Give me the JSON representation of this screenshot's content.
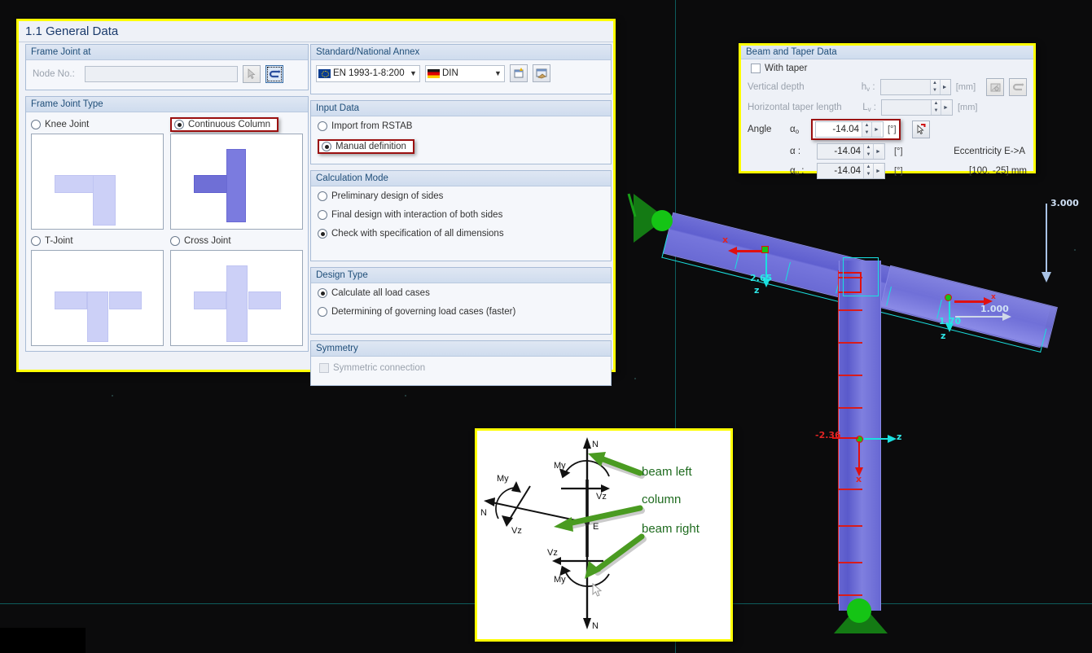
{
  "viewport": {
    "labels": [
      {
        "name": "dim-3000",
        "text": "3.000",
        "color": "#cfe0f5"
      },
      {
        "name": "dim-1000",
        "text": "1.000",
        "color": "#e8eef8"
      },
      {
        "name": "dim-265",
        "text": "2.65",
        "color": "#2ee6e6"
      },
      {
        "name": "dim-170",
        "text": "1.70",
        "color": "#2ee6e6"
      },
      {
        "name": "dim-236",
        "text": "-2.36",
        "color": "#e02424"
      },
      {
        "name": "axis-z-beam-top",
        "text": "z",
        "color": "#2ee6e6"
      },
      {
        "name": "axis-z-beam-mid",
        "text": "z",
        "color": "#2ee6e6"
      },
      {
        "name": "axis-z-column",
        "text": "z",
        "color": "#2ee6e6"
      },
      {
        "name": "axis-x-beam-top",
        "text": "x",
        "color": "#e02424"
      },
      {
        "name": "axis-x-beam-mid",
        "text": "x",
        "color": "#e02424"
      },
      {
        "name": "axis-x-column",
        "text": "x",
        "color": "#e02424"
      }
    ]
  },
  "general_dialog": {
    "title": "1.1 General Data",
    "frame_joint_at": {
      "group_label": "Frame Joint at",
      "node_label": "Node No.:",
      "node_value": "",
      "pick_icon": "pick-cursor-icon",
      "jump_icon": "jump-to-model-icon"
    },
    "frame_joint_type": {
      "group_label": "Frame Joint Type",
      "options": [
        {
          "label": "Knee Joint",
          "selected": false,
          "thumb": "knee-joint-thumbnail"
        },
        {
          "label": "Continuous Column",
          "selected": true,
          "thumb": "continuous-column-thumbnail"
        },
        {
          "label": "T-Joint",
          "selected": false,
          "thumb": "t-joint-thumbnail"
        },
        {
          "label": "Cross Joint",
          "selected": false,
          "thumb": "cross-joint-thumbnail"
        }
      ]
    },
    "standard_annex": {
      "group_label": "Standard/National Annex",
      "standard_value": "EN 1993-1-8:200",
      "standard_flag": "eu-flag-icon",
      "annex_value": "DIN",
      "annex_flag": "german-flag-icon",
      "new_button_icon": "new-standard-icon",
      "settings_button_icon": "configure-standard-icon"
    },
    "input_data": {
      "group_label": "Input Data",
      "options": [
        {
          "label": "Import from RSTAB",
          "selected": false
        },
        {
          "label": "Manual definition",
          "selected": true,
          "highlighted": true
        }
      ]
    },
    "calculation_mode": {
      "group_label": "Calculation Mode",
      "options": [
        {
          "label": "Preliminary design of sides",
          "selected": false
        },
        {
          "label": "Final design with interaction of both sides",
          "selected": false
        },
        {
          "label": "Check with specification of all dimensions",
          "selected": true
        }
      ]
    },
    "design_type": {
      "group_label": "Design Type",
      "options": [
        {
          "label": "Calculate all load cases",
          "selected": true
        },
        {
          "label": "Determining of governing load cases (faster)",
          "selected": false
        }
      ]
    },
    "symmetry": {
      "group_label": "Symmetry",
      "checkbox_label": "Symmetric connection",
      "checked": false,
      "disabled": true
    }
  },
  "taper_dialog": {
    "title": "Beam and Taper Data",
    "with_taper": {
      "label": "With taper",
      "checked": false
    },
    "rows": [
      {
        "label": "Vertical depth",
        "symbol": "h",
        "sub": "v",
        "value": "",
        "unit": "[mm]",
        "disabled": true
      },
      {
        "label": "Horizontal taper length",
        "symbol": "L",
        "sub": "v",
        "value": "",
        "unit": "[mm]",
        "disabled": true
      }
    ],
    "angle_label": "Angle",
    "angles": [
      {
        "symbol": "α",
        "sub": "o",
        "value": "-14.04",
        "unit": "[°]",
        "highlighted": true
      },
      {
        "symbol": "α",
        "sub": "",
        "value": "-14.04",
        "unit": "[°]",
        "suffix": ":"
      },
      {
        "symbol": "α",
        "sub": "u",
        "value": "-14.04",
        "unit": "[°]",
        "suffix": ":"
      }
    ],
    "pick_angle_icon": "pick-angle-from-model-icon",
    "taper_icons": [
      "taper-shape-icon",
      "taper-jump-icon"
    ],
    "eccentricity": {
      "label": "Eccentricity E->A",
      "value": "[100, -25] mm"
    }
  },
  "diagram_callout": {
    "annotations": [
      {
        "label": "beam left",
        "color": "#1f6b1f"
      },
      {
        "label": "column",
        "color": "#1f6b1f"
      },
      {
        "label": "beam right",
        "color": "#1f6b1f"
      }
    ],
    "force_labels": [
      {
        "name": "N-top",
        "text": "N"
      },
      {
        "name": "My-top",
        "text": "My"
      },
      {
        "name": "Vz-top",
        "text": "Vz"
      },
      {
        "name": "My-left",
        "text": "My"
      },
      {
        "name": "N-left",
        "text": "N"
      },
      {
        "name": "Vz-left",
        "text": "Vz"
      },
      {
        "name": "E-node",
        "text": "E"
      },
      {
        "name": "Vz-bottom",
        "text": "Vz"
      },
      {
        "name": "My-bottom",
        "text": "My"
      },
      {
        "name": "N-bottom",
        "text": "N"
      }
    ],
    "cursor_icon": "mouse-cursor-icon"
  },
  "colors": {
    "dialog_border": "#ffff00",
    "highlight_red": "#9b0f0f",
    "beam_purple": "#6a6ad4",
    "support_green": "#15a015",
    "axis_cyan": "#2ee6e6",
    "axis_red": "#e02424"
  }
}
